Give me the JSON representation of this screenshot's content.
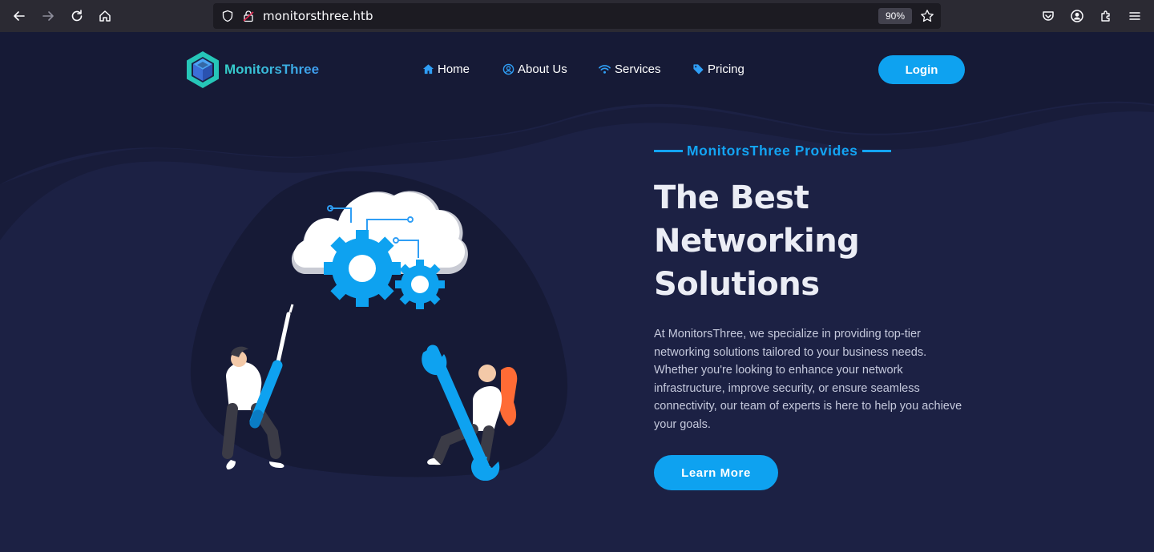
{
  "browser": {
    "url": "monitorsthree.htb",
    "zoom": "90%"
  },
  "site": {
    "logo_text": "MonitorsThree",
    "nav": [
      {
        "label": "Home",
        "icon": "home-icon"
      },
      {
        "label": "About Us",
        "icon": "user-circle-icon"
      },
      {
        "label": "Services",
        "icon": "wifi-icon"
      },
      {
        "label": "Pricing",
        "icon": "tag-icon"
      }
    ],
    "login_label": "Login"
  },
  "hero": {
    "eyebrow": "MonitorsThree Provides",
    "headline_lines": [
      "The Best",
      "Networking",
      "Solutions"
    ],
    "description": "At MonitorsThree, we specialize in providing top-tier networking solutions tailored to your business needs. Whether you're looking to enhance your network infrastructure, improve security, or ensure seamless connectivity, our team of experts is here to help you achieve your goals.",
    "cta_label": "Learn More"
  },
  "colors": {
    "accent": "#0ea2f0",
    "background": "#1c2144",
    "chrome": "#2b2a33"
  }
}
